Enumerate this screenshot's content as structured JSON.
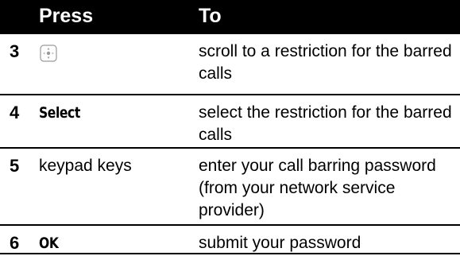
{
  "header": {
    "press": "Press",
    "to": "To"
  },
  "rows": [
    {
      "step": "3",
      "press_icon": "navigation-key-icon",
      "to": "scroll to a restriction for the barred calls"
    },
    {
      "step": "4",
      "press": "Select",
      "to": "select the restriction for the barred calls"
    },
    {
      "step": "5",
      "press": "keypad keys",
      "to": "enter your call barring password (from your network service provider)"
    },
    {
      "step": "6",
      "press": "OK",
      "to": "submit your password"
    }
  ]
}
